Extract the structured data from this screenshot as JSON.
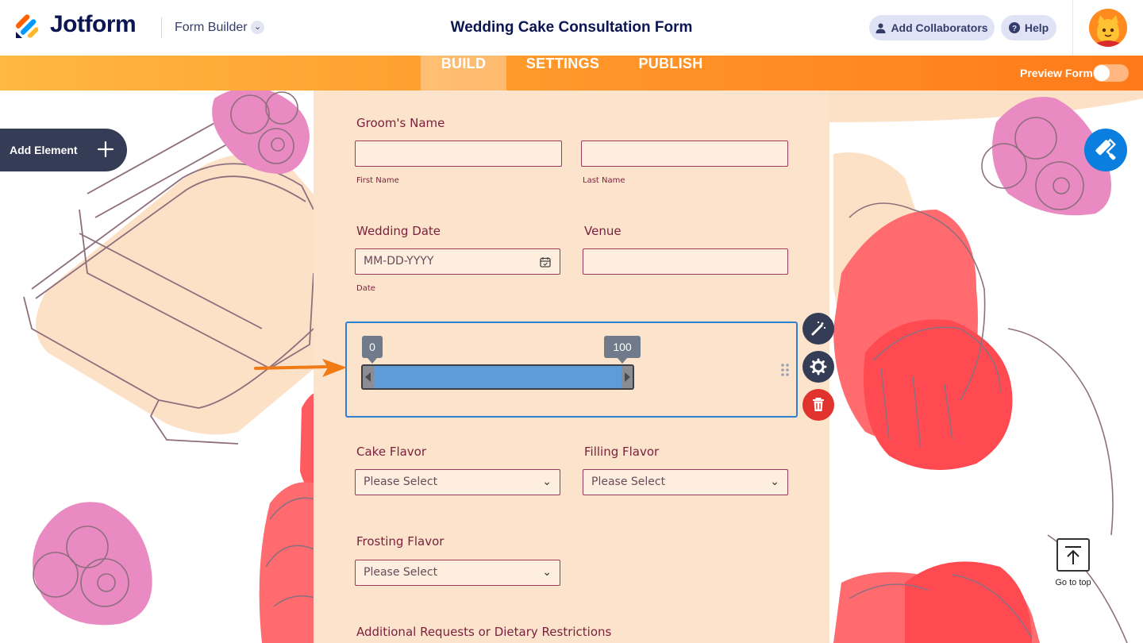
{
  "header": {
    "brand": "Jotform",
    "mode_label": "Form Builder",
    "form_title": "Wedding Cake Consultation Form",
    "collaborators_label": "Add Collaborators",
    "help_label": "Help"
  },
  "nav": {
    "tabs": [
      "BUILD",
      "SETTINGS",
      "PUBLISH"
    ],
    "active_tab": "BUILD",
    "preview_label": "Preview Form",
    "preview_enabled": false
  },
  "sidebar": {
    "add_element_label": "Add Element"
  },
  "form": {
    "groom_label": "Groom's Name",
    "first_name_sub": "First Name",
    "last_name_sub": "Last Name",
    "wedding_date_label": "Wedding Date",
    "date_placeholder": "MM-DD-YYYY",
    "date_sub": "Date",
    "venue_label": "Venue",
    "slider": {
      "min_label": "0",
      "max_label": "100",
      "range_start": 0,
      "range_end": 100
    },
    "cake_flavor_label": "Cake Flavor",
    "filling_flavor_label": "Filling Flavor",
    "frosting_flavor_label": "Frosting Flavor",
    "select_placeholder": "Please Select",
    "additional_label": "Additional Requests or Dietary Restrictions"
  },
  "go_to_top_label": "Go to top",
  "colors": {
    "brand_navy": "#0a1551",
    "nav_orange": "#ff7a1a",
    "form_background": "#fce3cc",
    "field_border": "#9b3a5a",
    "selection_blue": "#2f80d0",
    "delete_red": "#e0332d",
    "paint_blue": "#0a7fe0"
  },
  "icons": {
    "logo": "jotform-logo-icon",
    "collaborators": "user-icon",
    "help": "question-icon",
    "calendar": "calendar-icon",
    "wand": "magic-wand-icon",
    "settings": "gear-icon",
    "delete": "trash-icon",
    "drag": "drag-handle-icon",
    "paint": "paint-roller-icon",
    "go_top": "arrow-up-icon"
  }
}
